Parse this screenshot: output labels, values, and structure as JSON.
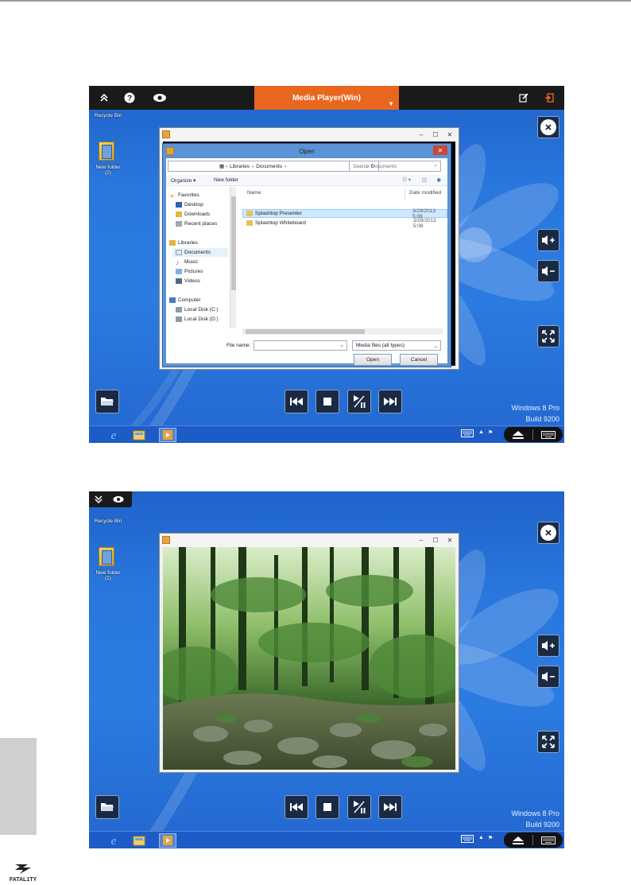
{
  "toolbar": {
    "title": "Media Player(Win)"
  },
  "desktop": {
    "recycle_bin": "Recycle Bin",
    "new_folder": "New folder",
    "new_folder_count": "(2)"
  },
  "os_label": {
    "line1": "Windows 8 Pro",
    "line2": "Build 9200"
  },
  "open_dialog": {
    "title": "Open",
    "address": [
      "Libraries",
      "Documents"
    ],
    "search_placeholder": "Search Documents",
    "organize": "Organize ▾",
    "new_folder": "New folder",
    "nav": {
      "favorites": "Favorites",
      "desktop": "Desktop",
      "downloads": "Downloads",
      "recent": "Recent places",
      "libraries": "Libraries",
      "documents": "Documents",
      "music": "Music",
      "pictures": "Pictures",
      "videos": "Videos",
      "computer": "Computer",
      "disk_c": "Local Disk (C:)",
      "disk_d": "Local Disk (D:)"
    },
    "columns": {
      "name": "Name",
      "date": "Date modified"
    },
    "files": [
      {
        "name": "Splashtop Presenter",
        "date": "3/29/2013 5:08"
      },
      {
        "name": "Splashtop Whiteboard",
        "date": "3/29/2013 5:08"
      }
    ],
    "file_name_label": "File name:",
    "filter": "Media files (all types)",
    "open_button": "Open",
    "cancel_button": "Cancel"
  },
  "colors": {
    "accent": "#e8661e",
    "desktop_blue": "#2b7be0",
    "toolbar": "#1a1a1a"
  },
  "icons": {
    "collapse": "double-chevron-up-icon",
    "help": "help-icon",
    "view": "eye-icon",
    "edit": "edit-icon",
    "exit": "exit-icon",
    "close": "close-circle-icon",
    "volume_up": "volume-up-icon",
    "volume_down": "volume-down-icon",
    "fullscreen": "fullscreen-icon",
    "open": "open-folder-icon",
    "previous": "skip-previous-icon",
    "stop": "stop-icon",
    "play_pause": "play-pause-icon",
    "next": "skip-next-icon"
  }
}
